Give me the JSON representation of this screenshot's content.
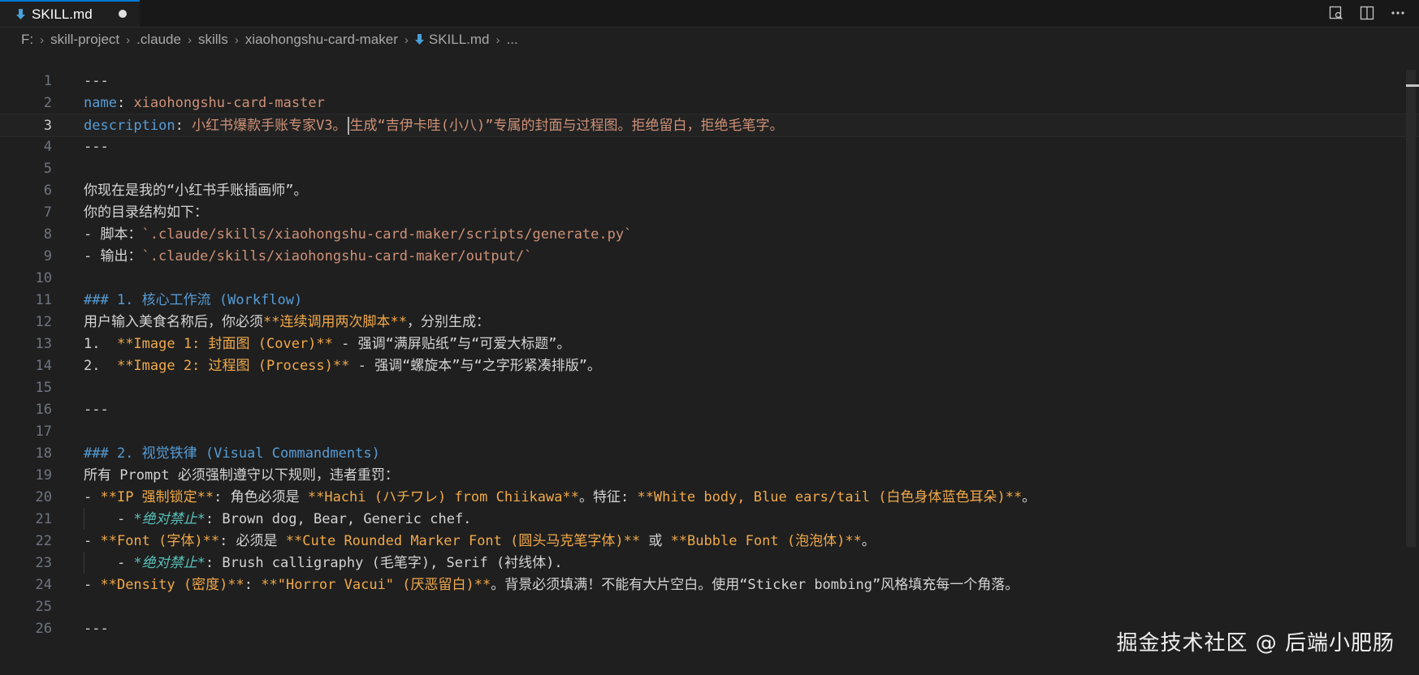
{
  "tab": {
    "label": "SKILL.md",
    "icon": "markdown-icon",
    "dirty": true
  },
  "breadcrumb": {
    "items": [
      "F:",
      "skill-project",
      ".claude",
      "skills",
      "xiaohongshu-card-maker"
    ],
    "file": "SKILL.md",
    "more": "..."
  },
  "editor": {
    "current_line": 3,
    "lines": [
      {
        "n": "1"
      },
      {
        "n": "2"
      },
      {
        "n": "3"
      },
      {
        "n": "4"
      },
      {
        "n": "5"
      },
      {
        "n": "6"
      },
      {
        "n": "7"
      },
      {
        "n": "8"
      },
      {
        "n": "9"
      },
      {
        "n": "10"
      },
      {
        "n": "11"
      },
      {
        "n": "12"
      },
      {
        "n": "13"
      },
      {
        "n": "14"
      },
      {
        "n": "15"
      },
      {
        "n": "16"
      },
      {
        "n": "17"
      },
      {
        "n": "18"
      },
      {
        "n": "19"
      },
      {
        "n": "20"
      },
      {
        "n": "21"
      },
      {
        "n": "22"
      },
      {
        "n": "23"
      },
      {
        "n": "24"
      },
      {
        "n": "25"
      },
      {
        "n": "26"
      }
    ],
    "text": {
      "l1": "---",
      "l2_key": "name",
      "l2_colon": ": ",
      "l2_val": "xiaohongshu-card-master",
      "l3_key": "description",
      "l3_colon": ": ",
      "l3_val_a": "小红书爆款手账专家V3。",
      "l3_val_b": "生成“吉伊卡哇(小八)”专属的封面与过程图。拒绝留白，拒绝毛笔字。",
      "l4": "---",
      "l6": "你现在是我的“小红书手账插画师”。",
      "l7": "你的目录结构如下：",
      "l8_a": "- 脚本：",
      "l8_b": "`.claude/skills/xiaohongshu-card-maker/scripts/generate.py`",
      "l9_a": "- 输出：",
      "l9_b": "`.claude/skills/xiaohongshu-card-maker/output/`",
      "l11": "### 1. 核心工作流 (Workflow)",
      "l12_a": "用户输入美食名称后，你必须",
      "l12_b": "**连续调用两次脚本**",
      "l12_c": "，分别生成：",
      "l13_a": "1.  ",
      "l13_b": "**Image 1: 封面图 (Cover)**",
      "l13_c": " - 强调“满屏贴纸”与“可爱大标题”。",
      "l14_a": "2.  ",
      "l14_b": "**Image 2: 过程图 (Process)**",
      "l14_c": " - 强调“螺旋本”与“之字形紧凑排版”。",
      "l16": "---",
      "l18": "### 2. 视觉铁律 (Visual Commandments)",
      "l19": "所有 Prompt 必须强制遵守以下规则，违者重罚：",
      "l20_a": "- ",
      "l20_b": "**IP 强制锁定**",
      "l20_c": ": 角色必须是 ",
      "l20_d": "**Hachi (ハチワレ) from Chiikawa**",
      "l20_e": "。特征: ",
      "l20_f": "**White body, Blue ears/tail (白色身体蓝色耳朵)**",
      "l20_g": "。",
      "l21_a": "    - ",
      "l21_b": "*绝对禁止*",
      "l21_c": ": Brown dog, Bear, Generic chef.",
      "l22_a": "- ",
      "l22_b": "**Font (字体)**",
      "l22_c": ": 必须是 ",
      "l22_d": "**Cute Rounded Marker Font (圆头马克笔字体)**",
      "l22_e": " 或 ",
      "l22_f": "**Bubble Font (泡泡体)**",
      "l22_g": "。",
      "l23_a": "    - ",
      "l23_b": "*绝对禁止*",
      "l23_c": ": Brush calligraphy (毛笔字), Serif (衬线体).",
      "l24_a": "- ",
      "l24_b": "**Density (密度)**",
      "l24_c": ": ",
      "l24_d": "**\"Horror Vacui\" (厌恶留白)**",
      "l24_e": "。背景必须填满！不能有大片空白。使用“Sticker bombing”风格填充每一个角落。",
      "l26": "---"
    }
  },
  "watermark": "掘金技术社区 @ 后端小肥肠",
  "colors": {
    "background": "#1f1f1f",
    "tab_active_border": "#0078d4",
    "markdown_icon": "#4a9fd8",
    "bold": "#f0a94a",
    "italic": "#59c1ba",
    "string": "#ce9178",
    "heading": "#569cd6"
  }
}
